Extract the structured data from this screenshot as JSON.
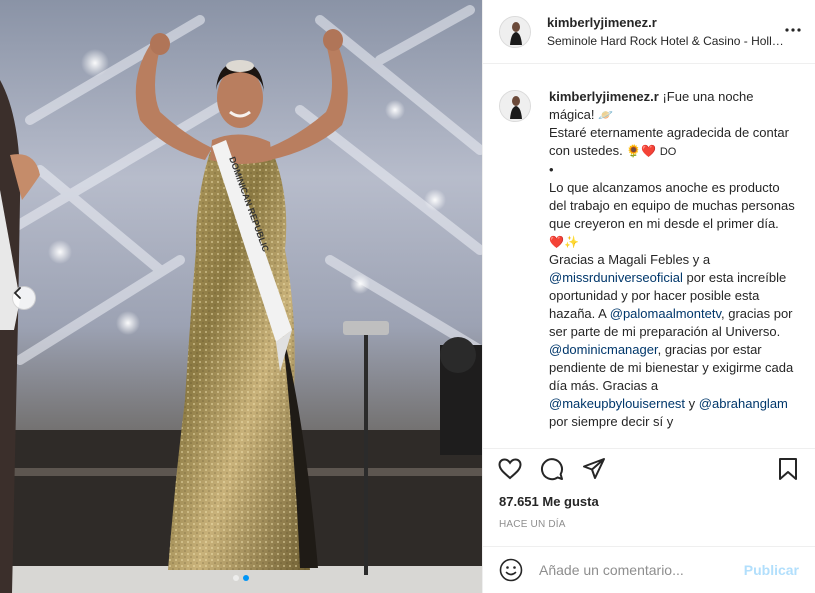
{
  "post": {
    "username": "kimberlyjimenez.r",
    "location": "Seminole Hard Rock Hotel & Casino - Hollyw…",
    "sash_text": "DOMINICAN REPUBLIC"
  },
  "caption": {
    "username": "kimberlyjimenez.r",
    "line1": "¡Fue una noche mágica!",
    "line1_emoji": "🪐",
    "line2": "Estaré eternamente agradecida de contar con ustedes.",
    "line2_emoji": "🌻❤️",
    "line2_tag": "DO",
    "bullet": "•",
    "p1": "Lo que alcanzamos anoche es producto del trabajo en equipo de muchas personas que creyeron en mi desde el primer día.",
    "p1_emoji": "❤️✨",
    "p2a": "Gracias a Magali Febles y a",
    "m1": "@missrduniverseoficial",
    "p2b": "por esta increíble oportunidad y por hacer posible esta hazaña. A",
    "m2": "@palomaalmontetv",
    "p2c": ", gracias por ser parte de mi preparación al Universo.",
    "m3": "@dominicmanager",
    "p2d": ", gracias por estar pendiente de mi bienestar y exigirme cada día más. Gracias a",
    "m4": "@makeupbylouisernest",
    "p2e": "y",
    "m5": "@abrahanglam",
    "p2f": "por siempre decir sí y"
  },
  "stats": {
    "likes": "87.651 Me gusta",
    "time": "HACE UN DÍA"
  },
  "comment_box": {
    "placeholder": "Añade un comentario...",
    "publish_label": "Publicar"
  },
  "icons": {
    "more": "more-horizontal-icon",
    "like": "heart-icon",
    "comment": "comment-icon",
    "share": "share-icon",
    "save": "bookmark-icon",
    "emoji": "emoji-icon",
    "prev": "chevron-left-icon"
  },
  "colors": {
    "mention": "#00376b",
    "publish_disabled": "#b2dffc",
    "muted": "#8e8e8e",
    "active_dot": "#0095f6"
  }
}
